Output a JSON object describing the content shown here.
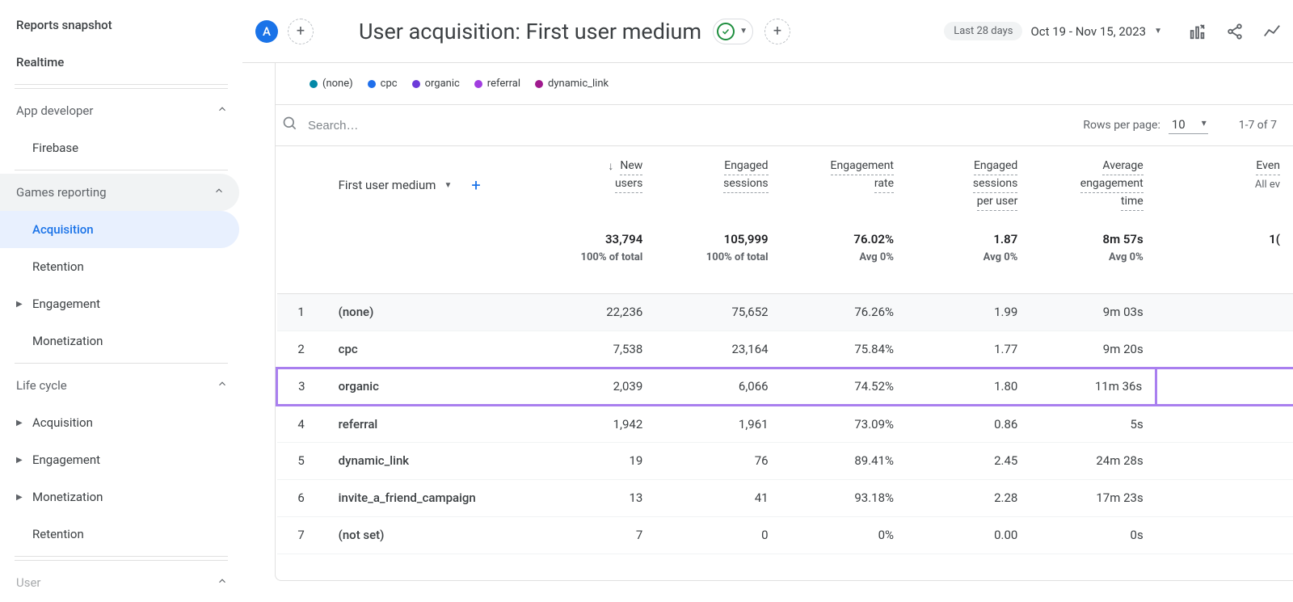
{
  "sidebar": {
    "items": [
      {
        "label": "Reports snapshot",
        "kind": "plain"
      },
      {
        "label": "Realtime",
        "kind": "plain"
      },
      {
        "label": "App developer",
        "kind": "section",
        "expand": "up"
      },
      {
        "label": "Firebase",
        "kind": "child"
      },
      {
        "label": "Games reporting",
        "kind": "section",
        "expand": "up",
        "bg": true
      },
      {
        "label": "Acquisition",
        "kind": "child",
        "active": true
      },
      {
        "label": "Retention",
        "kind": "child"
      },
      {
        "label": "Engagement",
        "kind": "child",
        "tri": true
      },
      {
        "label": "Monetization",
        "kind": "child"
      },
      {
        "label": "Life cycle",
        "kind": "section",
        "expand": "up"
      },
      {
        "label": "Acquisition",
        "kind": "child",
        "tri": true
      },
      {
        "label": "Engagement",
        "kind": "child",
        "tri": true
      },
      {
        "label": "Monetization",
        "kind": "child",
        "tri": true
      },
      {
        "label": "Retention",
        "kind": "child"
      },
      {
        "label": "User",
        "kind": "section",
        "expand": "up",
        "faded": true
      }
    ]
  },
  "header": {
    "avatar": "A",
    "title": "User acquisition: First user medium",
    "date_badge": "Last 28 days",
    "date_range": "Oct 19 - Nov 15, 2023"
  },
  "legend": [
    {
      "label": "(none)",
      "color": "#0288a7"
    },
    {
      "label": "cpc",
      "color": "#1f6feb"
    },
    {
      "label": "organic",
      "color": "#6c3bd9"
    },
    {
      "label": "referral",
      "color": "#a13de0"
    },
    {
      "label": "dynamic_link",
      "color": "#a01a8e"
    }
  ],
  "table": {
    "search_placeholder": "Search…",
    "rows_per_page_label": "Rows per page:",
    "rows_per_page": "10",
    "page_info": "1-7 of 7",
    "dimension": "First user medium",
    "columns": [
      {
        "name": "New\nusers",
        "sortArrow": true
      },
      {
        "name": "Engaged\nsessions",
        "sortArrow": false
      },
      {
        "name": "Engagement\nrate",
        "sortArrow": false
      },
      {
        "name": "Engaged\nsessions\nper user",
        "sortArrow": false
      },
      {
        "name": "Average\nengagement\ntime",
        "sortArrow": false
      },
      {
        "name": "Even",
        "sortArrow": false,
        "sub": "All ev"
      }
    ],
    "totals": {
      "values": [
        "33,794",
        "105,999",
        "76.02%",
        "1.87",
        "8m 57s",
        "1("
      ],
      "subs": [
        "100% of total",
        "100% of total",
        "Avg 0%",
        "Avg 0%",
        "Avg 0%",
        ""
      ]
    },
    "rows": [
      {
        "idx": "1",
        "dim": "(none)",
        "vals": [
          "22,236",
          "75,652",
          "76.26%",
          "1.99",
          "9m 03s",
          ""
        ]
      },
      {
        "idx": "2",
        "dim": "cpc",
        "vals": [
          "7,538",
          "23,164",
          "75.84%",
          "1.77",
          "9m 20s",
          ""
        ]
      },
      {
        "idx": "3",
        "dim": "organic",
        "vals": [
          "2,039",
          "6,066",
          "74.52%",
          "1.80",
          "11m 36s",
          ""
        ],
        "highlight": true
      },
      {
        "idx": "4",
        "dim": "referral",
        "vals": [
          "1,942",
          "1,961",
          "73.09%",
          "0.86",
          "5s",
          ""
        ]
      },
      {
        "idx": "5",
        "dim": "dynamic_link",
        "vals": [
          "19",
          "76",
          "89.41%",
          "2.45",
          "24m 28s",
          ""
        ]
      },
      {
        "idx": "6",
        "dim": "invite_a_friend_campaign",
        "vals": [
          "13",
          "41",
          "93.18%",
          "2.28",
          "17m 23s",
          ""
        ]
      },
      {
        "idx": "7",
        "dim": "(not set)",
        "vals": [
          "7",
          "0",
          "0%",
          "0.00",
          "0s",
          ""
        ]
      }
    ]
  }
}
